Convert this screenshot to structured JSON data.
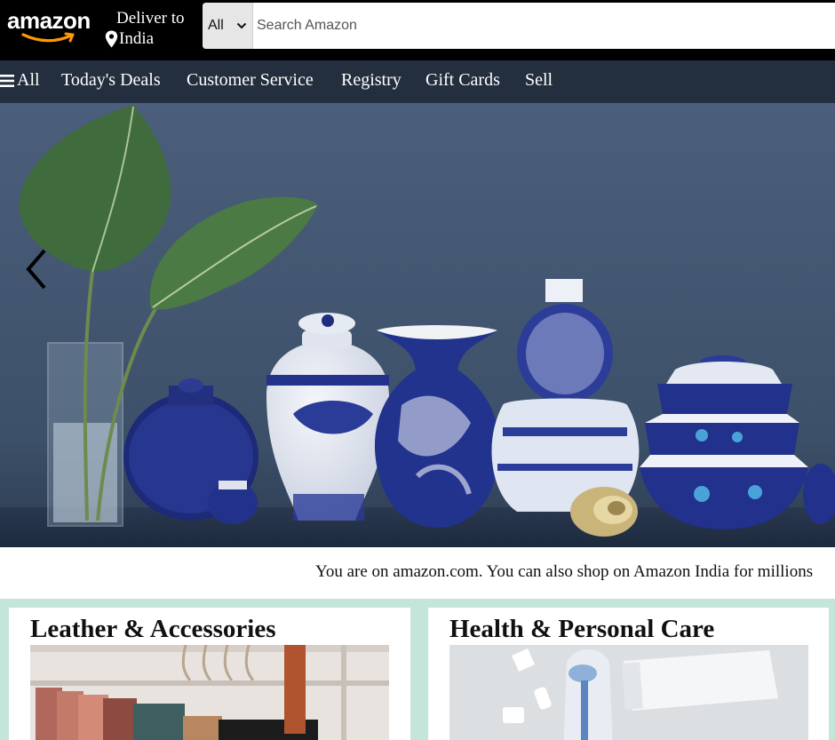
{
  "header": {
    "logo_text": "amazon",
    "deliver_label": "Deliver to",
    "deliver_location": "India",
    "search": {
      "category": "All",
      "placeholder": "Search Amazon"
    }
  },
  "nav": {
    "all_label": "All",
    "items": [
      "Today's Deals",
      "Customer Service",
      "Registry",
      "Gift Cards",
      "Sell"
    ]
  },
  "notice": {
    "text": "You are on amazon.com. You can also shop on Amazon India for millions"
  },
  "cards": [
    {
      "title": "Leather & Accessories"
    },
    {
      "title": "Health & Personal Care"
    }
  ],
  "colors": {
    "topbar": "#000000",
    "navbar": "#232f3e",
    "smile": "#f90",
    "cards_bg": "#c3e5da"
  },
  "icons": {
    "logo_smile": "amazon-smile-icon",
    "location": "location-pin-icon",
    "menu": "hamburger-icon",
    "dropdown": "chevron-down-icon",
    "carousel_prev": "chevron-left-icon"
  }
}
